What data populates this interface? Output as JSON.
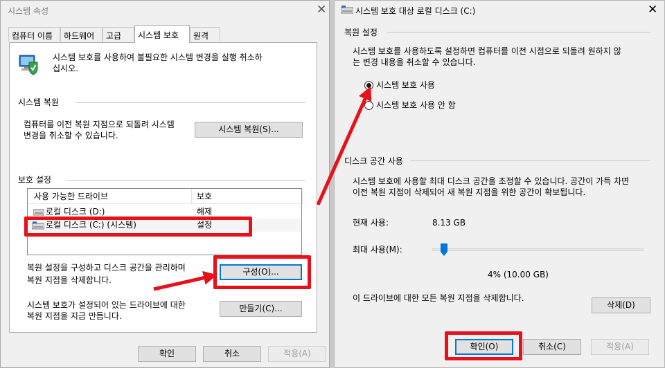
{
  "left_window": {
    "title": "시스템 속성",
    "tabs": [
      "컴퓨터 이름",
      "하드웨어",
      "고급",
      "시스템 보호",
      "원격"
    ],
    "active_tab": 3,
    "intro_line1": "시스템 보호를 사용하여 불필요한 시스템 변경을 실행 취소하",
    "intro_line2": "십시오.",
    "restore_group": "시스템 복원",
    "restore_desc_line1": "컴퓨터를 이전 복원 지점으로 되돌려 시스템",
    "restore_desc_line2": "변경을 취소할 수 있습니다.",
    "restore_button": "시스템 복원(S)...",
    "protection_group": "보호 설정",
    "drive_table": {
      "headers": [
        "사용 가능한 드라이브",
        "보호"
      ],
      "rows": [
        {
          "drive": "로컬 디스크 (D:)",
          "protection": "해제"
        },
        {
          "drive": "로컬 디스크 (C:) (시스템)",
          "protection": "설정"
        }
      ]
    },
    "configure_desc_line1": "복원 설정을 구성하고 디스크 공간을 관리하며",
    "configure_desc_line2": "복원 지점을 삭제합니다.",
    "configure_button": "구성(O)...",
    "create_desc_line1": "시스템 보호가 설정되어 있는 드라이브에 대한",
    "create_desc_line2": "복원 지점을 지금 만듭니다.",
    "create_button": "만들기(C)...",
    "ok_button": "확인",
    "cancel_button": "취소",
    "apply_button": "적용(A)"
  },
  "right_window": {
    "title": "시스템 보호 대상 로컬 디스크 (C:)",
    "restore_settings_group": "복원 설정",
    "restore_desc_line1": "시스템 보호를 사용하도록 설정하면 컴퓨터를 이전 시점으로 되돌려 원하지 않",
    "restore_desc_line2": "는 변경 내용을 취소할 수 있습니다.",
    "radio_on": "시스템 보호 사용",
    "radio_off": "시스템 보호 사용 안 함",
    "radio_selected": "on",
    "disk_usage_group": "디스크 공간 사용",
    "disk_desc_line1": "시스템 보호에 사용할 최대 디스크 공간을 조정할 수 있습니다. 공간이 가득 차면",
    "disk_desc_line2": "이전 복원 지점이 삭제되어 새 복원 지점을 위한 공간이 확보됩니다.",
    "current_usage_label": "현재 사용:",
    "current_usage_value": "8.13 GB",
    "max_usage_label": "최대 사용(M):",
    "max_usage_fraction": 0.04,
    "max_usage_value": "4% (10.00 GB)",
    "delete_desc": "이 드라이브에 대한 모든 복원 지점을 삭제합니다.",
    "delete_button": "삭제(D)",
    "ok_button": "확인(O)",
    "cancel_button": "취소(C)",
    "apply_button": "적용(A)"
  },
  "annotation_color": "#e8101a",
  "icons": [
    "system-protection-icon",
    "drive-icon",
    "system-drive-icon",
    "close-icon"
  ]
}
